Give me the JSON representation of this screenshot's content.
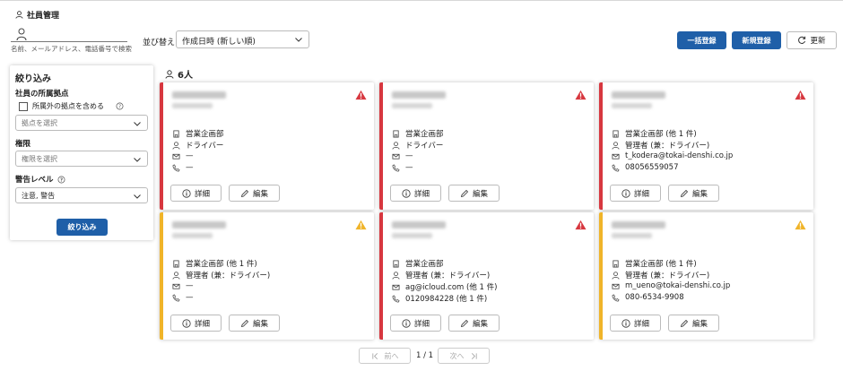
{
  "page": {
    "title": "社員管理",
    "search_placeholder": "名前、メールアドレス、電話番号で検索",
    "sort_label": "並び替え",
    "sort_value": "作成日時 (新しい順)",
    "buttons": {
      "bulk": "一括登録",
      "new": "新規登録",
      "refresh": "更新"
    }
  },
  "filter": {
    "heading": "絞り込み",
    "location_label": "社員の所属拠点",
    "include_other": "所属外の拠点を含める",
    "location_placeholder": "拠点を選択",
    "role_label": "権限",
    "role_placeholder": "権限を選択",
    "warning_label": "警告レベル",
    "warning_value": "注意, 警告",
    "apply": "絞り込み"
  },
  "count": "6人",
  "card_buttons": {
    "detail": "詳細",
    "edit": "編集"
  },
  "cards": [
    {
      "dept": "営業企画部",
      "role": "ドライバー",
      "email": "—",
      "phone": "—",
      "level": "error",
      "bar": "#d7373f"
    },
    {
      "dept": "営業企画部",
      "role": "ドライバー",
      "email": "—",
      "phone": "—",
      "level": "error",
      "bar": "#d7373f"
    },
    {
      "dept": "営業企画部 (他 1 件)",
      "role": "管理者 (兼：ドライバー)",
      "email": "t_kodera@tokai-denshi.co.jp",
      "phone": "08056559057",
      "level": "error",
      "bar": "#d7373f"
    },
    {
      "dept": "営業企画部 (他 1 件)",
      "role": "管理者 (兼：ドライバー)",
      "email": "—",
      "phone": "—",
      "level": "warning",
      "bar": "#f0b429"
    },
    {
      "dept": "営業企画部",
      "role": "管理者 (兼：ドライバー)",
      "email": "ag@icloud.com (他 1 件)",
      "phone": "0120984228 (他 1 件)",
      "level": "error",
      "bar": "#d7373f"
    },
    {
      "dept": "営業企画部 (他 1 件)",
      "role": "管理者 (兼：ドライバー)",
      "email": "m_ueno@tokai-denshi.co.jp",
      "phone": "080-6534-9908",
      "level": "warning",
      "bar": "#f0b429"
    }
  ],
  "pager": {
    "prev": "前へ",
    "next": "次へ",
    "page": "1 / 1"
  },
  "colors": {
    "primary": "#1f5fa8",
    "error": "#d7373f",
    "warning": "#f0b429"
  }
}
